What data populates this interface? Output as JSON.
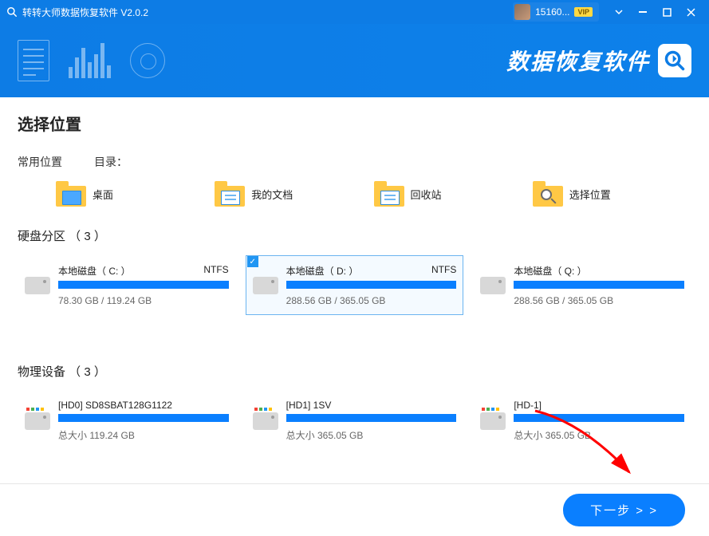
{
  "titlebar": {
    "app_title": "转转大师数据恢复软件 V2.0.2",
    "user_id": "15160...",
    "vip_label": "VIP"
  },
  "banner": {
    "title": "数据恢复软件"
  },
  "page": {
    "heading": "选择位置",
    "common_label": "常用位置",
    "dir_label": "目录：",
    "places": [
      {
        "label": "桌面"
      },
      {
        "label": "我的文档"
      },
      {
        "label": "回收站"
      },
      {
        "label": "选择位置"
      }
    ],
    "partitions_title": "硬盘分区 （ 3 ）",
    "partitions": [
      {
        "name": "本地磁盘（ C: ）",
        "fs": "NTFS",
        "size": "78.30 GB / 119.24 GB",
        "selected": false
      },
      {
        "name": "本地磁盘（ D: ）",
        "fs": "NTFS",
        "size": "288.56 GB / 365.05 GB",
        "selected": true
      },
      {
        "name": "本地磁盘（ Q: ）",
        "fs": "",
        "size": "288.56 GB / 365.05 GB",
        "selected": false
      }
    ],
    "devices_title": "物理设备 （ 3 ）",
    "devices": [
      {
        "name": "[HD0] SD8SBAT128G1122",
        "size": "总大小 119.24 GB"
      },
      {
        "name": "[HD1] 1SV",
        "size": "总大小 365.05 GB"
      },
      {
        "name": "[HD-1]",
        "size": "总大小 365.05 GB"
      }
    ],
    "next_label": "下一步  > >"
  }
}
